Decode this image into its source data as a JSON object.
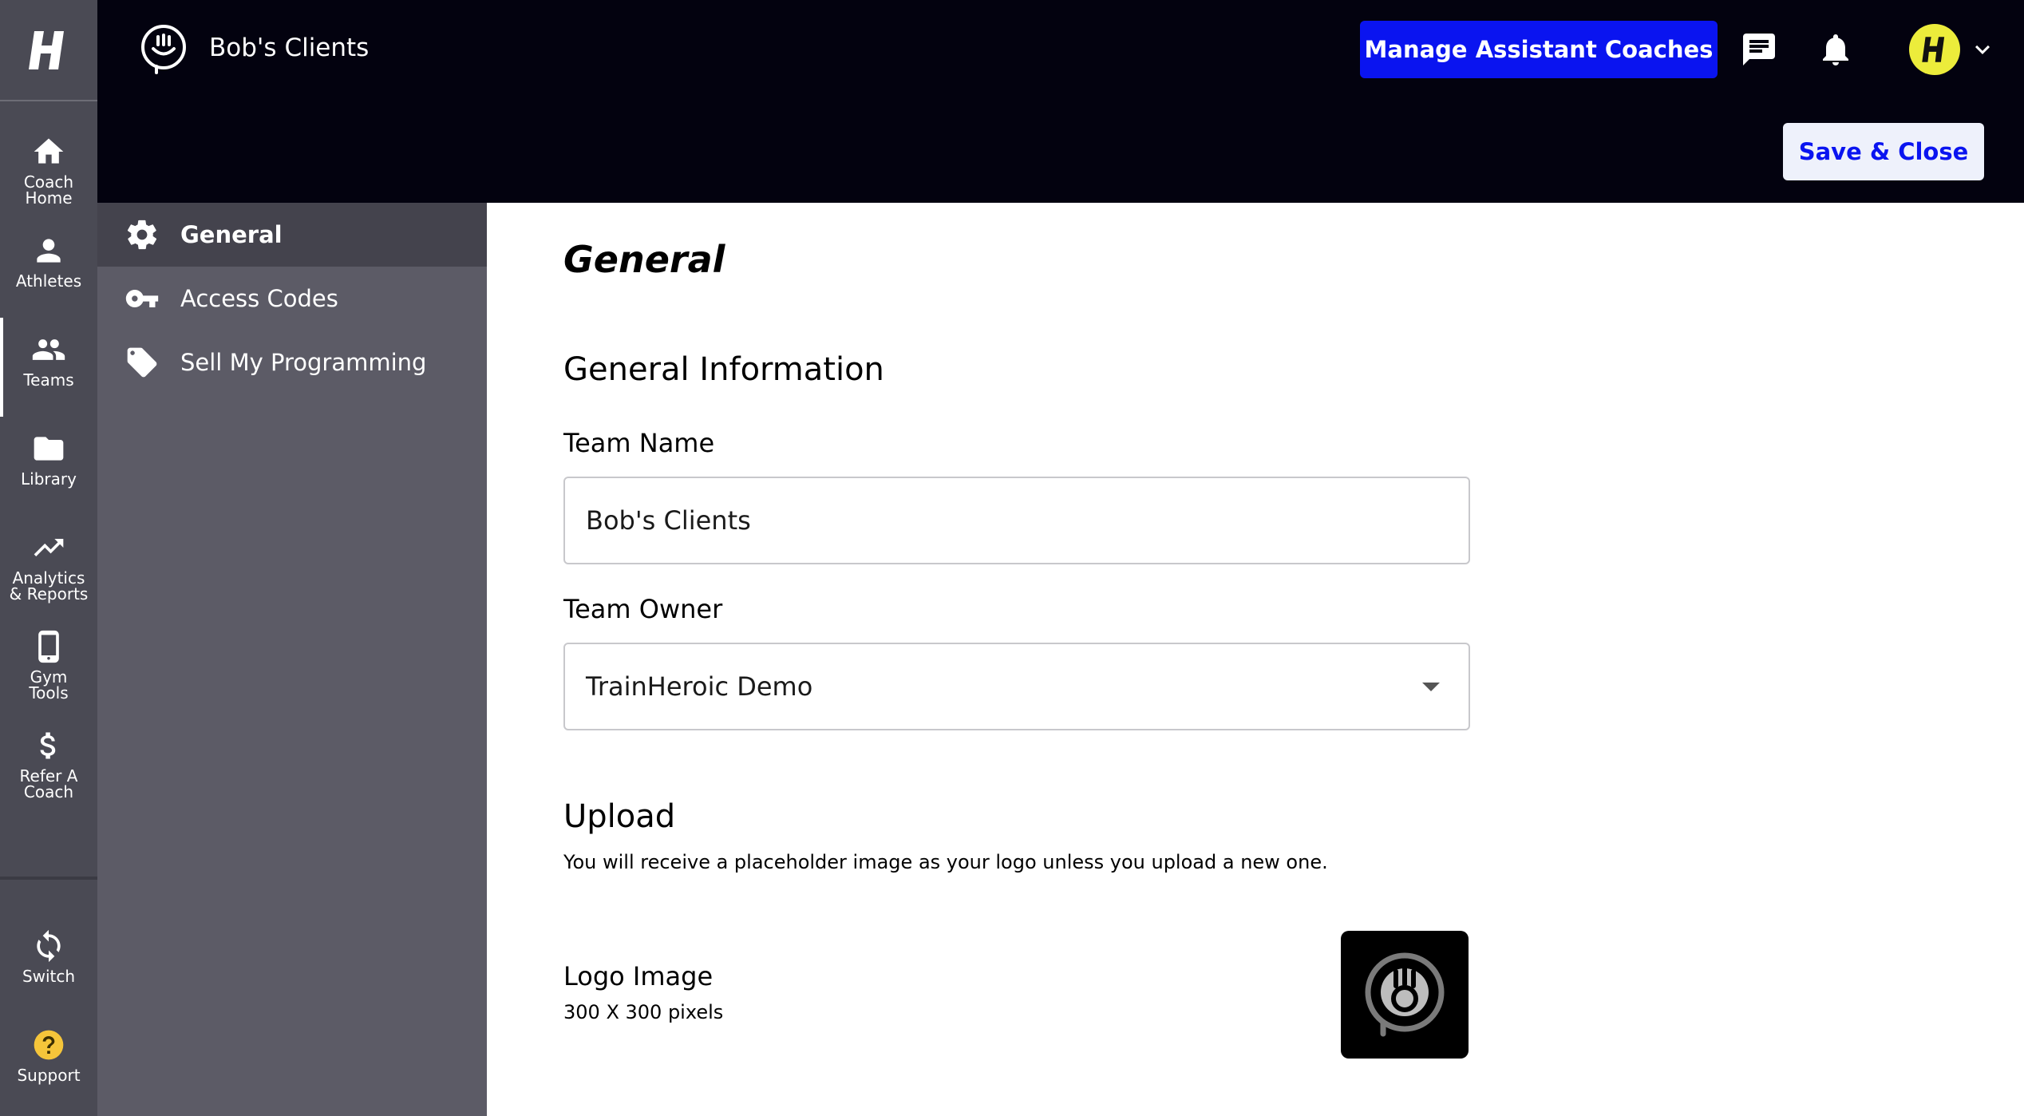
{
  "rail": {
    "items": [
      {
        "label": "Coach Home",
        "icon": "home-icon"
      },
      {
        "label": "Athletes",
        "icon": "person-icon"
      },
      {
        "label": "Teams",
        "icon": "people-icon",
        "active": true
      },
      {
        "label": "Library",
        "icon": "folder-icon"
      },
      {
        "label": "Analytics & Reports",
        "icon": "trending-up-icon"
      },
      {
        "label": "Gym Tools",
        "icon": "phone-icon"
      },
      {
        "label": "Refer A Coach",
        "icon": "dollar-icon"
      }
    ],
    "bottom": [
      {
        "label": "Switch",
        "icon": "sync-icon"
      },
      {
        "label": "Support",
        "icon": "help-icon"
      }
    ]
  },
  "header": {
    "team_name": "Bob's Clients",
    "manage_button": "Manage Assistant Coaches",
    "save_button": "Save & Close"
  },
  "subnav": {
    "items": [
      {
        "label": "General",
        "icon": "gear-icon",
        "active": true
      },
      {
        "label": "Access Codes",
        "icon": "key-icon"
      },
      {
        "label": "Sell My Programming",
        "icon": "tag-icon"
      }
    ]
  },
  "main": {
    "page_title": "General",
    "general_info_title": "General Information",
    "team_name_label": "Team Name",
    "team_name_value": "Bob's Clients",
    "team_owner_label": "Team Owner",
    "team_owner_value": "TrainHeroic Demo",
    "upload_title": "Upload",
    "upload_desc": "You will receive a placeholder image as your logo unless you upload a new one.",
    "logo_label": "Logo Image",
    "logo_size": "300 X 300 pixels"
  },
  "colors": {
    "accent": "#0a14f0",
    "topbar": "#03020f",
    "rail": "#4a4a54",
    "subnav": "#5c5b66",
    "avatar": "#ecec3b"
  }
}
